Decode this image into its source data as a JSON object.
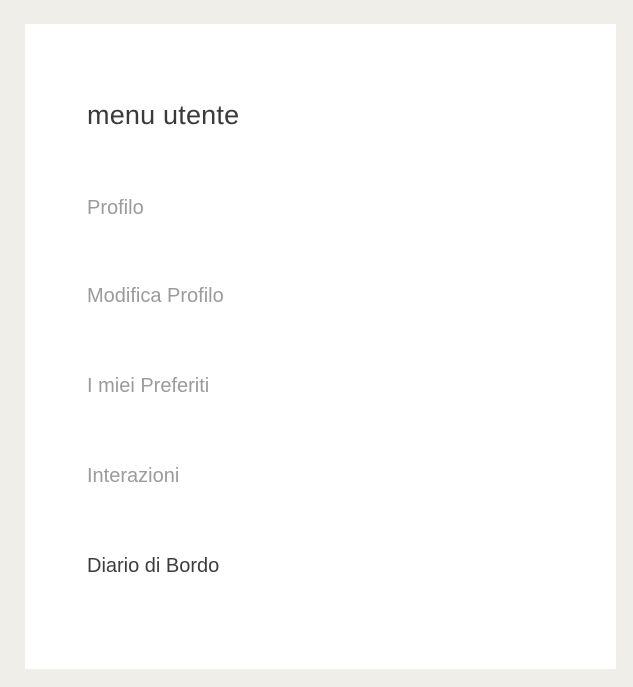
{
  "user_menu": {
    "title": "menu utente",
    "items": [
      {
        "label": "Profilo",
        "active": false
      },
      {
        "label": "Modifica Profilo",
        "active": false
      },
      {
        "label": "I miei Preferiti",
        "active": false
      },
      {
        "label": "Interazioni",
        "active": false
      },
      {
        "label": "Diario di Bordo",
        "active": true
      }
    ]
  },
  "colors": {
    "page_background": "#efeee9",
    "panel_background": "#ffffff",
    "title_text": "#3a3a3a",
    "menu_item_text": "#9b9b9b",
    "menu_item_active_text": "#3d3d3d"
  }
}
